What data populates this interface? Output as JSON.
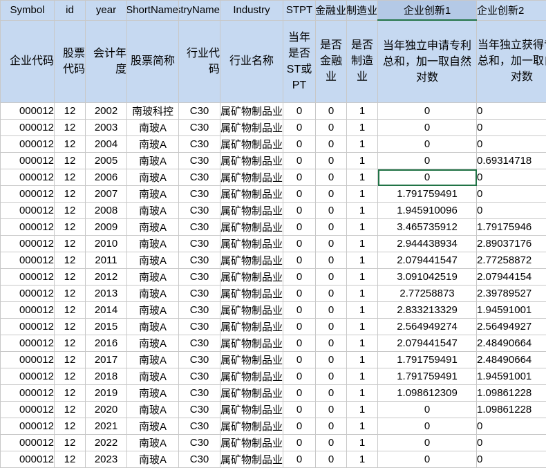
{
  "columns": [
    "Symbol",
    "id",
    "year",
    "ShortName",
    "IndustryName",
    "Industry",
    "STPT",
    "金融业",
    "制造业",
    "企业创新1",
    "企业创新2"
  ],
  "descriptions": [
    "企业代码",
    "股票代码",
    "会计年度",
    "股票简称",
    "行业代码",
    "行业名称",
    "当年是否ST或PT",
    "是否金融业",
    "是否制造业",
    "当年独立申请专利总和，加一取自然对数",
    "当年独立获得专利总和，加一取自然对数"
  ],
  "rows": [
    [
      "000012",
      "12",
      "2002",
      "南玻科控",
      "C30",
      "非金属矿物制品业",
      "0",
      "0",
      "1",
      "0",
      "0"
    ],
    [
      "000012",
      "12",
      "2003",
      "南玻A",
      "C30",
      "非金属矿物制品业",
      "0",
      "0",
      "1",
      "0",
      "0"
    ],
    [
      "000012",
      "12",
      "2004",
      "南玻A",
      "C30",
      "非金属矿物制品业",
      "0",
      "0",
      "1",
      "0",
      "0"
    ],
    [
      "000012",
      "12",
      "2005",
      "南玻A",
      "C30",
      "非金属矿物制品业",
      "0",
      "0",
      "1",
      "0",
      "0.69314718"
    ],
    [
      "000012",
      "12",
      "2006",
      "南玻A",
      "C30",
      "非金属矿物制品业",
      "0",
      "0",
      "1",
      "0",
      "0"
    ],
    [
      "000012",
      "12",
      "2007",
      "南玻A",
      "C30",
      "非金属矿物制品业",
      "0",
      "0",
      "1",
      "1.791759491",
      "0"
    ],
    [
      "000012",
      "12",
      "2008",
      "南玻A",
      "C30",
      "非金属矿物制品业",
      "0",
      "0",
      "1",
      "1.945910096",
      "0"
    ],
    [
      "000012",
      "12",
      "2009",
      "南玻A",
      "C30",
      "非金属矿物制品业",
      "0",
      "0",
      "1",
      "3.465735912",
      "1.79175946"
    ],
    [
      "000012",
      "12",
      "2010",
      "南玻A",
      "C30",
      "非金属矿物制品业",
      "0",
      "0",
      "1",
      "2.944438934",
      "2.89037176"
    ],
    [
      "000012",
      "12",
      "2011",
      "南玻A",
      "C30",
      "非金属矿物制品业",
      "0",
      "0",
      "1",
      "2.079441547",
      "2.77258872"
    ],
    [
      "000012",
      "12",
      "2012",
      "南玻A",
      "C30",
      "非金属矿物制品业",
      "0",
      "0",
      "1",
      "3.091042519",
      "2.07944154"
    ],
    [
      "000012",
      "12",
      "2013",
      "南玻A",
      "C30",
      "非金属矿物制品业",
      "0",
      "0",
      "1",
      "2.77258873",
      "2.39789527"
    ],
    [
      "000012",
      "12",
      "2014",
      "南玻A",
      "C30",
      "非金属矿物制品业",
      "0",
      "0",
      "1",
      "2.833213329",
      "1.94591001"
    ],
    [
      "000012",
      "12",
      "2015",
      "南玻A",
      "C30",
      "非金属矿物制品业",
      "0",
      "0",
      "1",
      "2.564949274",
      "2.56494927"
    ],
    [
      "000012",
      "12",
      "2016",
      "南玻A",
      "C30",
      "非金属矿物制品业",
      "0",
      "0",
      "1",
      "2.079441547",
      "2.48490664"
    ],
    [
      "000012",
      "12",
      "2017",
      "南玻A",
      "C30",
      "非金属矿物制品业",
      "0",
      "0",
      "1",
      "1.791759491",
      "2.48490664"
    ],
    [
      "000012",
      "12",
      "2018",
      "南玻A",
      "C30",
      "非金属矿物制品业",
      "0",
      "0",
      "1",
      "1.791759491",
      "1.94591001"
    ],
    [
      "000012",
      "12",
      "2019",
      "南玻A",
      "C30",
      "非金属矿物制品业",
      "0",
      "0",
      "1",
      "1.098612309",
      "1.09861228"
    ],
    [
      "000012",
      "12",
      "2020",
      "南玻A",
      "C30",
      "非金属矿物制品业",
      "0",
      "0",
      "1",
      "0",
      "1.09861228"
    ],
    [
      "000012",
      "12",
      "2021",
      "南玻A",
      "C30",
      "非金属矿物制品业",
      "0",
      "0",
      "1",
      "0",
      "0"
    ],
    [
      "000012",
      "12",
      "2022",
      "南玻A",
      "C30",
      "非金属矿物制品业",
      "0",
      "0",
      "1",
      "0",
      "0"
    ],
    [
      "000012",
      "12",
      "2023",
      "南玻A",
      "C30",
      "非金属矿物制品业",
      "0",
      "0",
      "1",
      "0",
      "0"
    ]
  ],
  "selection": {
    "active_column": 9,
    "active_row": 4
  }
}
